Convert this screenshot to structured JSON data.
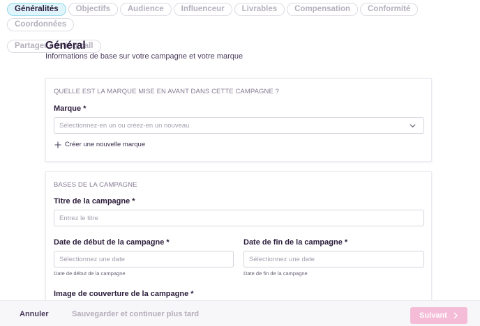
{
  "tabs": [
    {
      "label": "Généralités",
      "active": true
    },
    {
      "label": "Objectifs"
    },
    {
      "label": "Audience"
    },
    {
      "label": "Influenceur"
    },
    {
      "label": "Livrables"
    },
    {
      "label": "Compensation"
    },
    {
      "label": "Conformité"
    },
    {
      "label": "Coordonnées"
    },
    {
      "label": "Partager casting call"
    }
  ],
  "header": {
    "title": "Général",
    "subtitle": "Informations de base sur votre campagne et votre marque"
  },
  "brand_section": {
    "title": "QUELLE EST LA MARQUE MISE EN AVANT DANS CETTE CAMPAGNE ?",
    "brand_label": "Marque *",
    "brand_placeholder": "Sélectionnez-en un ou créez-en un nouveau",
    "create_brand_label": "Créer une nouvelle marque"
  },
  "basics_section": {
    "title": "BASES DE LA CAMPAGNE",
    "campaign_title_label": "Titre de la campagne *",
    "campaign_title_placeholder": "Entrez le titre",
    "start_date_label": "Date de début de la campagne *",
    "start_date_placeholder": "Sélectionnez une date",
    "start_date_hint": "Date de début de la campagne",
    "end_date_label": "Date de fin de la campagne *",
    "end_date_placeholder": "Sélectionnez une date",
    "end_date_hint": "Date de fin de la campagne",
    "cover_image_label": "Image de couverture de la campagne *"
  },
  "footer": {
    "cancel_label": "Annuler",
    "save_later_label": "Sauvegarder et continuer plus tard",
    "next_label": "Suivant"
  },
  "colors": {
    "active_tab_bg": "#dff5fb",
    "active_tab_border": "#8fd8ec",
    "primary_disabled": "#f4bcd7",
    "text_dark": "#2b1c3b"
  },
  "icons": {
    "select_chevron": "chevron-down-icon",
    "create_brand": "plus-icon",
    "next": "chevron-right-icon"
  }
}
